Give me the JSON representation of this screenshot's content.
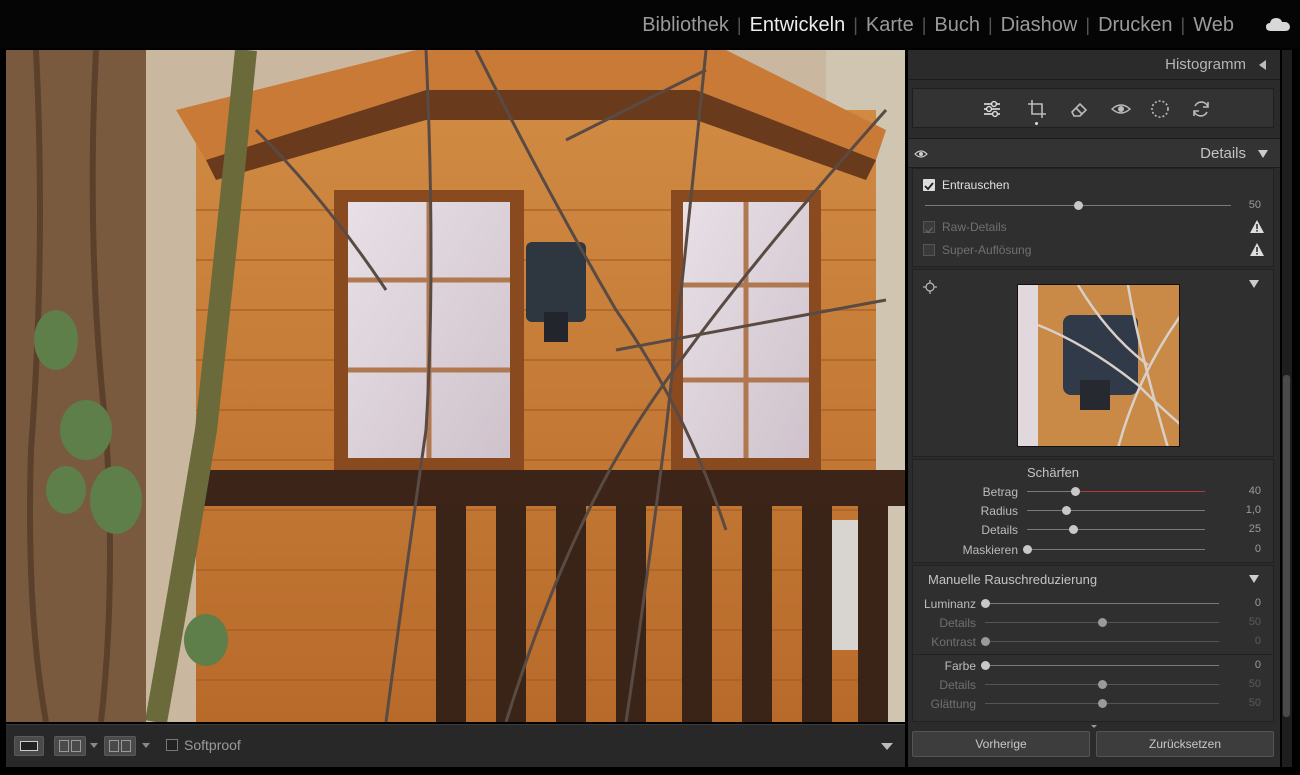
{
  "top_nav": {
    "modules": [
      {
        "label": "Bibliothek",
        "active": false
      },
      {
        "label": "Entwickeln",
        "active": true
      },
      {
        "label": "Karte",
        "active": false
      },
      {
        "label": "Buch",
        "active": false
      },
      {
        "label": "Diashow",
        "active": false
      },
      {
        "label": "Drucken",
        "active": false
      },
      {
        "label": "Web",
        "active": false
      }
    ],
    "cloud_icon": "cloud-icon"
  },
  "toolbar": {
    "softproof_label": "Softproof",
    "softproof_checked": false,
    "view_buttons": [
      "loupe-view-icon",
      "before-after-icon",
      "before-after-split-icon"
    ]
  },
  "panel": {
    "histogram_title": "Histogramm",
    "tools": [
      "edit-sliders-icon",
      "crop-icon",
      "healing-icon",
      "red-eye-icon",
      "masking-icon",
      "reset-tool-icon"
    ],
    "details_title": "Details",
    "denoise": {
      "label": "Entrauschen",
      "checked": true,
      "value": "50",
      "amount": 50,
      "raw_details": "Raw-Details",
      "super_resolution": "Super-Auflösung"
    },
    "sharpening": {
      "title": "Schärfen",
      "rows": [
        {
          "label": "Betrag",
          "value": "40",
          "pos": 0.27
        },
        {
          "label": "Radius",
          "value": "1,0",
          "pos": 0.22
        },
        {
          "label": "Details",
          "value": "25",
          "pos": 0.26
        },
        {
          "label": "Maskieren",
          "value": "0",
          "pos": 0.0
        }
      ]
    },
    "manual_nr": {
      "title": "Manuelle Rauschreduzierung",
      "luminance": [
        {
          "label": "Luminanz",
          "value": "0",
          "pos": 0.0
        },
        {
          "label": "Details",
          "value": "50",
          "pos": 0.5
        },
        {
          "label": "Kontrast",
          "value": "0",
          "pos": 0.0
        }
      ],
      "color": [
        {
          "label": "Farbe",
          "value": "0",
          "pos": 0.0
        },
        {
          "label": "Details",
          "value": "50",
          "pos": 0.5
        },
        {
          "label": "Glättung",
          "value": "50",
          "pos": 0.5
        }
      ]
    },
    "buttons": {
      "previous": "Vorherige",
      "reset": "Zurücksetzen"
    }
  },
  "colors": {
    "accent_red": "#b03a3a",
    "panel_bg": "#2b2b2b"
  }
}
